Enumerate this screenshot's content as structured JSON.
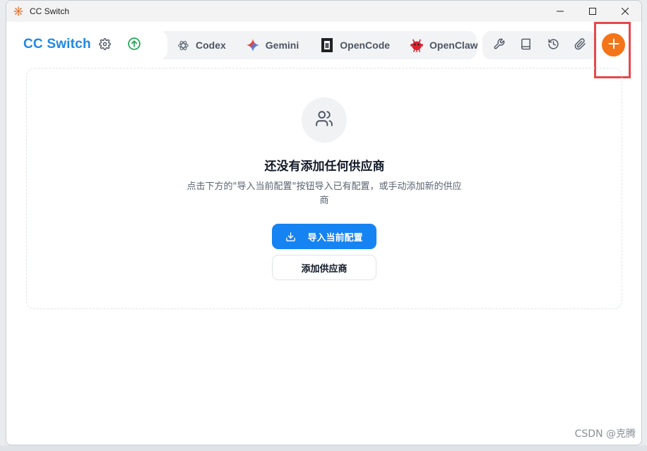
{
  "window": {
    "title": "CC Switch"
  },
  "header": {
    "brand": "CC Switch",
    "tabs": [
      {
        "label": "Codex",
        "icon": "openai-icon"
      },
      {
        "label": "Gemini",
        "icon": "gemini-star-icon"
      },
      {
        "label": "OpenCode",
        "icon": "opencode-icon"
      },
      {
        "label": "OpenClaw",
        "icon": "openclaw-icon"
      }
    ],
    "tools": [
      "wrench-icon",
      "book-icon",
      "history-icon",
      "paperclip-icon"
    ],
    "add_button_icon": "plus-icon"
  },
  "empty_state": {
    "title": "还没有添加任何供应商",
    "description": "点击下方的\"导入当前配置\"按钮导入已有配置，或手动添加新的供应商",
    "import_button": "导入当前配置",
    "add_button": "添加供应商"
  },
  "watermark": "CSDN @克腾",
  "colors": {
    "brand": "#1e88e5",
    "primary": "#1683f2",
    "add": "#f47419",
    "highlight": "#e5484d",
    "update": "#16a34a"
  }
}
